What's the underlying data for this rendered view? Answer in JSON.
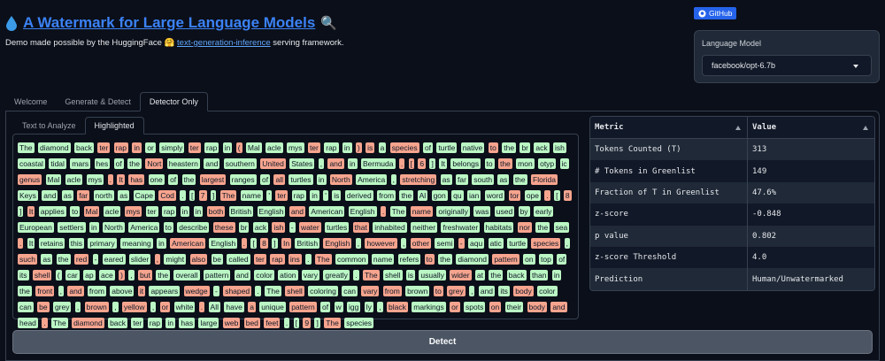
{
  "header": {
    "title": "A Watermark for Large Language Models",
    "title_emoji": "🔍",
    "subtitle_prefix": "Demo made possible by the HuggingFace",
    "subtitle_emoji": "🤗",
    "subtitle_link": "text-generation-inference",
    "subtitle_suffix": "serving framework.",
    "github_label": "GitHub"
  },
  "language_model": {
    "label": "Language Model",
    "selected": "facebook/opt-6.7b"
  },
  "tabs": [
    "Welcome",
    "Generate & Detect",
    "Detector Only"
  ],
  "active_tab": 2,
  "subtabs": [
    "Text to Analyze",
    "Highlighted"
  ],
  "active_subtab": 1,
  "highlighted_tokens": [
    [
      "The",
      "g"
    ],
    [
      "diamond",
      "g"
    ],
    [
      "back",
      "g"
    ],
    [
      "ter",
      "r"
    ],
    [
      "rap",
      "r"
    ],
    [
      "in",
      "r"
    ],
    [
      "or",
      "g"
    ],
    [
      "simply",
      "g"
    ],
    [
      "ter",
      "r"
    ],
    [
      "rap",
      "g"
    ],
    [
      "in",
      "g"
    ],
    [
      "(",
      "r"
    ],
    [
      "Mal",
      "g"
    ],
    [
      "acle",
      "g"
    ],
    [
      "mys",
      "g"
    ],
    [
      "ter",
      "r"
    ],
    [
      "rap",
      "g"
    ],
    [
      "in",
      "g"
    ],
    [
      ")",
      "r"
    ],
    [
      "is",
      "r"
    ],
    [
      "a",
      "g"
    ],
    [
      "species",
      "r"
    ],
    [
      "of",
      "g"
    ],
    [
      "turtle",
      "g"
    ],
    [
      "native",
      "g"
    ],
    [
      "to",
      "r"
    ],
    [
      "the",
      "g"
    ],
    [
      "br",
      "g"
    ],
    [
      "ack",
      "g"
    ],
    [
      "ish",
      "g"
    ],
    [
      "coastal",
      "g"
    ],
    [
      "tidal",
      "g"
    ],
    [
      "mars",
      "g"
    ],
    [
      "hes",
      "g"
    ],
    [
      "of",
      "g"
    ],
    [
      "the",
      "g"
    ],
    [
      "Nort",
      "r"
    ],
    [
      "heastern",
      "g"
    ],
    [
      "and",
      "g"
    ],
    [
      "southern",
      "g"
    ],
    [
      "United",
      "r"
    ],
    [
      "States",
      "g"
    ],
    [
      ",",
      "g"
    ],
    [
      "and",
      "r"
    ],
    [
      "in",
      "g"
    ],
    [
      "Bermuda",
      "g"
    ],
    [
      ".",
      "r"
    ],
    [
      "[",
      "r"
    ],
    [
      "6",
      "r"
    ],
    [
      "]",
      "g"
    ],
    [
      "It",
      "g"
    ],
    [
      "belongs",
      "g"
    ],
    [
      "to",
      "g"
    ],
    [
      "the",
      "r"
    ],
    [
      "mon",
      "g"
    ],
    [
      "otyp",
      "g"
    ],
    [
      "ic",
      "g"
    ],
    [
      "genus",
      "r"
    ],
    [
      "Mal",
      "g"
    ],
    [
      "acle",
      "g"
    ],
    [
      "mys",
      "g"
    ],
    [
      ".",
      "r"
    ],
    [
      "It",
      "r"
    ],
    [
      "has",
      "r"
    ],
    [
      "one",
      "g"
    ],
    [
      "of",
      "g"
    ],
    [
      "the",
      "g"
    ],
    [
      "largest",
      "r"
    ],
    [
      "ranges",
      "g"
    ],
    [
      "of",
      "g"
    ],
    [
      "all",
      "r"
    ],
    [
      "turtles",
      "g"
    ],
    [
      "in",
      "g"
    ],
    [
      "North",
      "r"
    ],
    [
      "America",
      "g"
    ],
    [
      ",",
      "g"
    ],
    [
      "stretching",
      "r"
    ],
    [
      "as",
      "g"
    ],
    [
      "far",
      "g"
    ],
    [
      "south",
      "g"
    ],
    [
      "as",
      "g"
    ],
    [
      "the",
      "g"
    ],
    [
      "Florida",
      "r"
    ],
    [
      "Keys",
      "g"
    ],
    [
      "and",
      "g"
    ],
    [
      "as",
      "g"
    ],
    [
      "far",
      "r"
    ],
    [
      "north",
      "g"
    ],
    [
      "as",
      "g"
    ],
    [
      "Cape",
      "g"
    ],
    [
      "Cod",
      "r"
    ],
    [
      ".",
      "g"
    ],
    [
      "[",
      "g"
    ],
    [
      "7",
      "r"
    ],
    [
      "]",
      "g"
    ],
    [
      "The",
      "r"
    ],
    [
      "name",
      "g"
    ],
    [
      "'",
      "g"
    ],
    [
      "ter",
      "r"
    ],
    [
      "rap",
      "g"
    ],
    [
      "in",
      "g"
    ],
    [
      "'",
      "g"
    ],
    [
      "is",
      "g"
    ],
    [
      "derived",
      "g"
    ],
    [
      "from",
      "g"
    ],
    [
      "the",
      "g"
    ],
    [
      "Al",
      "g"
    ],
    [
      "gon",
      "g"
    ],
    [
      "qu",
      "g"
    ],
    [
      "ian",
      "g"
    ],
    [
      "word",
      "g"
    ],
    [
      "tor",
      "r"
    ],
    [
      "ope",
      "g"
    ],
    [
      ".",
      "r"
    ],
    [
      "[",
      "g"
    ],
    [
      "8",
      "r"
    ],
    [
      "]",
      "g"
    ],
    [
      "It",
      "r"
    ],
    [
      "applies",
      "g"
    ],
    [
      "to",
      "g"
    ],
    [
      "Mal",
      "r"
    ],
    [
      "acle",
      "g"
    ],
    [
      "mys",
      "r"
    ],
    [
      "ter",
      "g"
    ],
    [
      "rap",
      "g"
    ],
    [
      "in",
      "g"
    ],
    [
      "in",
      "g"
    ],
    [
      "both",
      "r"
    ],
    [
      "British",
      "g"
    ],
    [
      "English",
      "g"
    ],
    [
      "and",
      "r"
    ],
    [
      "American",
      "g"
    ],
    [
      "English",
      "g"
    ],
    [
      ".",
      "r"
    ],
    [
      "The",
      "g"
    ],
    [
      "name",
      "r"
    ],
    [
      "originally",
      "g"
    ],
    [
      "was",
      "g"
    ],
    [
      "used",
      "g"
    ],
    [
      "by",
      "g"
    ],
    [
      "early",
      "g"
    ],
    [
      "European",
      "g"
    ],
    [
      "settlers",
      "g"
    ],
    [
      "in",
      "g"
    ],
    [
      "North",
      "g"
    ],
    [
      "America",
      "g"
    ],
    [
      "to",
      "g"
    ],
    [
      "describe",
      "g"
    ],
    [
      "these",
      "r"
    ],
    [
      "br",
      "g"
    ],
    [
      "ack",
      "g"
    ],
    [
      "ish",
      "r"
    ],
    [
      "-",
      "g"
    ],
    [
      "water",
      "r"
    ],
    [
      "turtles",
      "g"
    ],
    [
      "that",
      "r"
    ],
    [
      "inhabited",
      "g"
    ],
    [
      "neither",
      "g"
    ],
    [
      "freshwater",
      "g"
    ],
    [
      "habitats",
      "g"
    ],
    [
      "nor",
      "r"
    ],
    [
      "the",
      "g"
    ],
    [
      "sea",
      "g"
    ],
    [
      ".",
      "r"
    ],
    [
      "It",
      "g"
    ],
    [
      "retains",
      "g"
    ],
    [
      "this",
      "g"
    ],
    [
      "primary",
      "g"
    ],
    [
      "meaning",
      "g"
    ],
    [
      "in",
      "g"
    ],
    [
      "American",
      "r"
    ],
    [
      "English",
      "g"
    ],
    [
      ".",
      "r"
    ],
    [
      "[",
      "g"
    ],
    [
      "8",
      "r"
    ],
    [
      "]",
      "g"
    ],
    [
      "In",
      "r"
    ],
    [
      "British",
      "g"
    ],
    [
      "English",
      "r"
    ],
    [
      ",",
      "g"
    ],
    [
      "however",
      "r"
    ],
    [
      ",",
      "g"
    ],
    [
      "other",
      "r"
    ],
    [
      "semi",
      "g"
    ],
    [
      "-",
      "r"
    ],
    [
      "aqu",
      "g"
    ],
    [
      "atic",
      "g"
    ],
    [
      "turtle",
      "g"
    ],
    [
      "species",
      "r"
    ],
    [
      ",",
      "g"
    ],
    [
      "such",
      "r"
    ],
    [
      "as",
      "g"
    ],
    [
      "the",
      "g"
    ],
    [
      "red",
      "r"
    ],
    [
      "-",
      "g"
    ],
    [
      "eared",
      "g"
    ],
    [
      "slider",
      "g"
    ],
    [
      ",",
      "r"
    ],
    [
      "might",
      "g"
    ],
    [
      "also",
      "r"
    ],
    [
      "be",
      "g"
    ],
    [
      "called",
      "g"
    ],
    [
      "ter",
      "r"
    ],
    [
      "rap",
      "r"
    ],
    [
      "ins",
      "r"
    ],
    [
      ".",
      "g"
    ],
    [
      "The",
      "r"
    ],
    [
      "common",
      "g"
    ],
    [
      "name",
      "g"
    ],
    [
      "refers",
      "g"
    ],
    [
      "to",
      "r"
    ],
    [
      "the",
      "g"
    ],
    [
      "diamond",
      "g"
    ],
    [
      "pattern",
      "r"
    ],
    [
      "on",
      "g"
    ],
    [
      "top",
      "g"
    ],
    [
      "of",
      "g"
    ],
    [
      "its",
      "g"
    ],
    [
      "shell",
      "r"
    ],
    [
      "(",
      "g"
    ],
    [
      "car",
      "g"
    ],
    [
      "ap",
      "g"
    ],
    [
      "ace",
      "g"
    ],
    [
      ")",
      "r"
    ],
    [
      ",",
      "g"
    ],
    [
      "but",
      "r"
    ],
    [
      "the",
      "g"
    ],
    [
      "overall",
      "g"
    ],
    [
      "pattern",
      "g"
    ],
    [
      "and",
      "g"
    ],
    [
      "color",
      "g"
    ],
    [
      "ation",
      "g"
    ],
    [
      "vary",
      "g"
    ],
    [
      "greatly",
      "g"
    ],
    [
      ".",
      "g"
    ],
    [
      "The",
      "r"
    ],
    [
      "shell",
      "g"
    ],
    [
      "is",
      "g"
    ],
    [
      "usually",
      "g"
    ],
    [
      "wider",
      "r"
    ],
    [
      "at",
      "g"
    ],
    [
      "the",
      "g"
    ],
    [
      "back",
      "g"
    ],
    [
      "than",
      "g"
    ],
    [
      "in",
      "g"
    ],
    [
      "the",
      "g"
    ],
    [
      "front",
      "r"
    ],
    [
      ",",
      "g"
    ],
    [
      "and",
      "r"
    ],
    [
      "from",
      "g"
    ],
    [
      "above",
      "g"
    ],
    [
      "it",
      "r"
    ],
    [
      "appears",
      "g"
    ],
    [
      "wedge",
      "r"
    ],
    [
      "-",
      "g"
    ],
    [
      "shaped",
      "r"
    ],
    [
      ".",
      "g"
    ],
    [
      "The",
      "g"
    ],
    [
      "shell",
      "r"
    ],
    [
      "coloring",
      "g"
    ],
    [
      "can",
      "g"
    ],
    [
      "vary",
      "r"
    ],
    [
      "from",
      "r"
    ],
    [
      "brown",
      "g"
    ],
    [
      "to",
      "r"
    ],
    [
      "grey",
      "r"
    ],
    [
      ",",
      "g"
    ],
    [
      "and",
      "g"
    ],
    [
      "its",
      "g"
    ],
    [
      "body",
      "r"
    ],
    [
      "color",
      "g"
    ],
    [
      "can",
      "g"
    ],
    [
      "be",
      "r"
    ],
    [
      "grey",
      "g"
    ],
    [
      ",",
      "g"
    ],
    [
      "brown",
      "r"
    ],
    [
      ",",
      "g"
    ],
    [
      "yellow",
      "r"
    ],
    [
      ",",
      "g"
    ],
    [
      "or",
      "r"
    ],
    [
      "white",
      "g"
    ],
    [
      ".",
      "r"
    ],
    [
      "All",
      "g"
    ],
    [
      "have",
      "g"
    ],
    [
      "a",
      "r"
    ],
    [
      "unique",
      "g"
    ],
    [
      "pattern",
      "r"
    ],
    [
      "of",
      "g"
    ],
    [
      "w",
      "g"
    ],
    [
      "igg",
      "g"
    ],
    [
      "ly",
      "g"
    ],
    [
      ",",
      "g"
    ],
    [
      "black",
      "r"
    ],
    [
      "markings",
      "g"
    ],
    [
      "or",
      "r"
    ],
    [
      "spots",
      "g"
    ],
    [
      "on",
      "r"
    ],
    [
      "their",
      "g"
    ],
    [
      "body",
      "r"
    ],
    [
      "and",
      "r"
    ],
    [
      "head",
      "g"
    ],
    [
      ".",
      "r"
    ],
    [
      "The",
      "g"
    ],
    [
      "diamond",
      "r"
    ],
    [
      "back",
      "g"
    ],
    [
      "ter",
      "g"
    ],
    [
      "rap",
      "g"
    ],
    [
      "in",
      "g"
    ],
    [
      "has",
      "g"
    ],
    [
      "large",
      "g"
    ],
    [
      "web",
      "r"
    ],
    [
      "bed",
      "r"
    ],
    [
      "feet",
      "r"
    ],
    [
      ".",
      "g"
    ],
    [
      "[",
      "g"
    ],
    [
      "9",
      "r"
    ],
    [
      "]",
      "g"
    ],
    [
      "The",
      "r"
    ],
    [
      "species",
      "g"
    ]
  ],
  "metrics_table": {
    "headers": [
      "Metric",
      "Value"
    ],
    "rows": [
      [
        "Tokens Counted (T)",
        "313"
      ],
      [
        "# Tokens in Greenlist",
        "149"
      ],
      [
        "Fraction of T in Greenlist",
        "47.6%"
      ],
      [
        "z-score",
        "-0.848"
      ],
      [
        "p value",
        "0.802"
      ],
      [
        "z-score Threshold",
        "4.0"
      ],
      [
        "Prediction",
        "Human/Unwatermarked"
      ]
    ]
  },
  "detect_button": "Detect",
  "colors": {
    "green_token": "#bbf7c4",
    "red_token": "#f7a48e",
    "accent": "#2563eb",
    "background": "#0b0f19"
  }
}
